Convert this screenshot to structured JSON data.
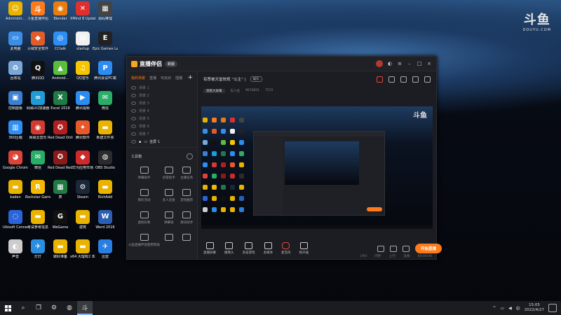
{
  "desktop": {
    "icons": [
      {
        "label": "Administr...",
        "color": "#e9b300",
        "glyph": "☺"
      },
      {
        "label": "斗鱼直播伴侣",
        "color": "#ff7a1a",
        "glyph": "斗"
      },
      {
        "label": "Blender",
        "color": "#e87d0d",
        "glyph": "◉"
      },
      {
        "label": "XMind 8 Update 9",
        "color": "#e02f2f",
        "glyph": "✕"
      },
      {
        "label": "源码推理",
        "color": "#444444",
        "glyph": "▦"
      },
      {
        "label": "此电脑",
        "color": "#3a8ee6",
        "glyph": "▭"
      },
      {
        "label": "火绒安全软件",
        "color": "#e25b2a",
        "glyph": "◆"
      },
      {
        "label": "CCtalk",
        "color": "#2f8ef3",
        "glyph": "◎"
      },
      {
        "label": "startup",
        "color": "#f0f0f0",
        "glyph": "▤"
      },
      {
        "label": "Epic Games Launcher",
        "color": "#222222",
        "glyph": "E"
      },
      {
        "label": "回收站",
        "color": "#7aa7d8",
        "glyph": "♻"
      },
      {
        "label": "腾讯QQ",
        "color": "#111111",
        "glyph": "Q"
      },
      {
        "label": "Android...",
        "color": "#5bbd3c",
        "glyph": "▲"
      },
      {
        "label": "QQ音乐",
        "color": "#f7c600",
        "glyph": "♫"
      },
      {
        "label": "腾讯会议PC端",
        "color": "#2d8cf0",
        "glyph": "P"
      },
      {
        "label": "控制面板",
        "color": "#3b7fd1",
        "glyph": "▣"
      },
      {
        "label": "网易UU加速器",
        "color": "#1f9bd6",
        "glyph": "∞"
      },
      {
        "label": "Excel 2016",
        "color": "#1f7a44",
        "glyph": "X"
      },
      {
        "label": "腾讯视频",
        "color": "#2d8cf0",
        "glyph": "▶"
      },
      {
        "label": "微信",
        "color": "#2aae67",
        "glyph": "✉"
      },
      {
        "label": "360压缩",
        "color": "#2f8ef3",
        "glyph": "▥"
      },
      {
        "label": "网易云音乐",
        "color": "#d33a31",
        "glyph": "◉"
      },
      {
        "label": "Red Dead Online",
        "color": "#b11f1f",
        "glyph": "✪"
      },
      {
        "label": "腾讯软件",
        "color": "#e8582a",
        "glyph": "✦"
      },
      {
        "label": "新建文件夹",
        "color": "#e9b300",
        "glyph": "▬"
      },
      {
        "label": "Google Chrome",
        "color": "#db4437",
        "glyph": "◕"
      },
      {
        "label": "微信",
        "color": "#2aae67",
        "glyph": "✉"
      },
      {
        "label": "Red Dead Redempti...",
        "color": "#8b1a1a",
        "glyph": "✪"
      },
      {
        "label": "华为应用市场",
        "color": "#cf2a2a",
        "glyph": "◆"
      },
      {
        "label": "OBS Studio",
        "color": "#2b2b2b",
        "glyph": "◍"
      },
      {
        "label": "kaden",
        "color": "#e9b300",
        "glyph": "▬"
      },
      {
        "label": "Rockstar Games...",
        "color": "#f5b800",
        "glyph": "R"
      },
      {
        "label": "表",
        "color": "#1f7a44",
        "glyph": "▦"
      },
      {
        "label": "Steam",
        "color": "#1b2838",
        "glyph": "⚙"
      },
      {
        "label": "RichAdd",
        "color": "#e9b300",
        "glyph": "▬"
      },
      {
        "label": "Ubisoft Connect",
        "color": "#2b64d9",
        "glyph": "◌"
      },
      {
        "label": "考试参考信息",
        "color": "#e9b300",
        "glyph": "▬"
      },
      {
        "label": "WeGame",
        "color": "#111111",
        "glyph": "G"
      },
      {
        "label": "建筑",
        "color": "#e9b300",
        "glyph": "▬"
      },
      {
        "label": "Word 2016",
        "color": "#2b5fb4",
        "glyph": "W"
      },
      {
        "label": "声音",
        "color": "#cccccc",
        "glyph": "◐"
      },
      {
        "label": "灯灯",
        "color": "#2b8de0",
        "glyph": "✈"
      },
      {
        "label": "做好准备",
        "color": "#e9b300",
        "glyph": "▬"
      },
      {
        "label": "x64 大理有2 本期文件 (3)",
        "color": "#e9b300",
        "glyph": "▬"
      },
      {
        "label": "迅雷",
        "color": "#2a7de1",
        "glyph": "✈"
      }
    ],
    "watermark": {
      "logo": "斗鱼",
      "sub": "DOUYU.COM"
    }
  },
  "app": {
    "brand": "直播伴侣",
    "version": "新版",
    "left_tabs": [
      "我的场景",
      "直播",
      "可派对",
      "插播"
    ],
    "scenes": [
      "场景 1",
      "场景 2",
      "场景 3",
      "场景 4",
      "场景 5",
      "场景 6",
      "场景 7"
    ],
    "current_scene": "全屏 1",
    "toolbox_title": "工具箱",
    "tools": [
      "弹幕助手",
      "房管助手",
      "主播任务",
      "我的活动",
      "多人连麦",
      "游戏推荐",
      "虚拟形象",
      "弹幕墙",
      "歌词助手",
      "斗鱼直播伴侣使用帮助",
      "",
      ""
    ],
    "main_title": "有赞被天堂效规 “公主” |",
    "main_tag": "娱乐",
    "sub_chips": [
      "观看大屏幕",
      "实人名",
      "9670831",
      "7572"
    ],
    "bottom_items": [
      "直播屏幕",
      "摄像头",
      "多宿游戏",
      "多媒体",
      "麦克风",
      "扬声器"
    ],
    "start_button": "开始直播",
    "status": [
      "CPU:",
      "内存:",
      "上行:",
      "丢帧:",
      "00:00:00"
    ]
  },
  "preview": {
    "watermark": "斗鱼"
  },
  "taskbar": {
    "time": "15:05",
    "date": "2022/4/27",
    "lang": "中",
    "apps": [
      {
        "name": "search",
        "glyph": "⌕"
      },
      {
        "name": "taskview",
        "glyph": "❐"
      },
      {
        "name": "settings",
        "glyph": "⚙"
      },
      {
        "name": "steam",
        "glyph": "◍"
      },
      {
        "name": "douyu",
        "glyph": "斗"
      }
    ]
  }
}
